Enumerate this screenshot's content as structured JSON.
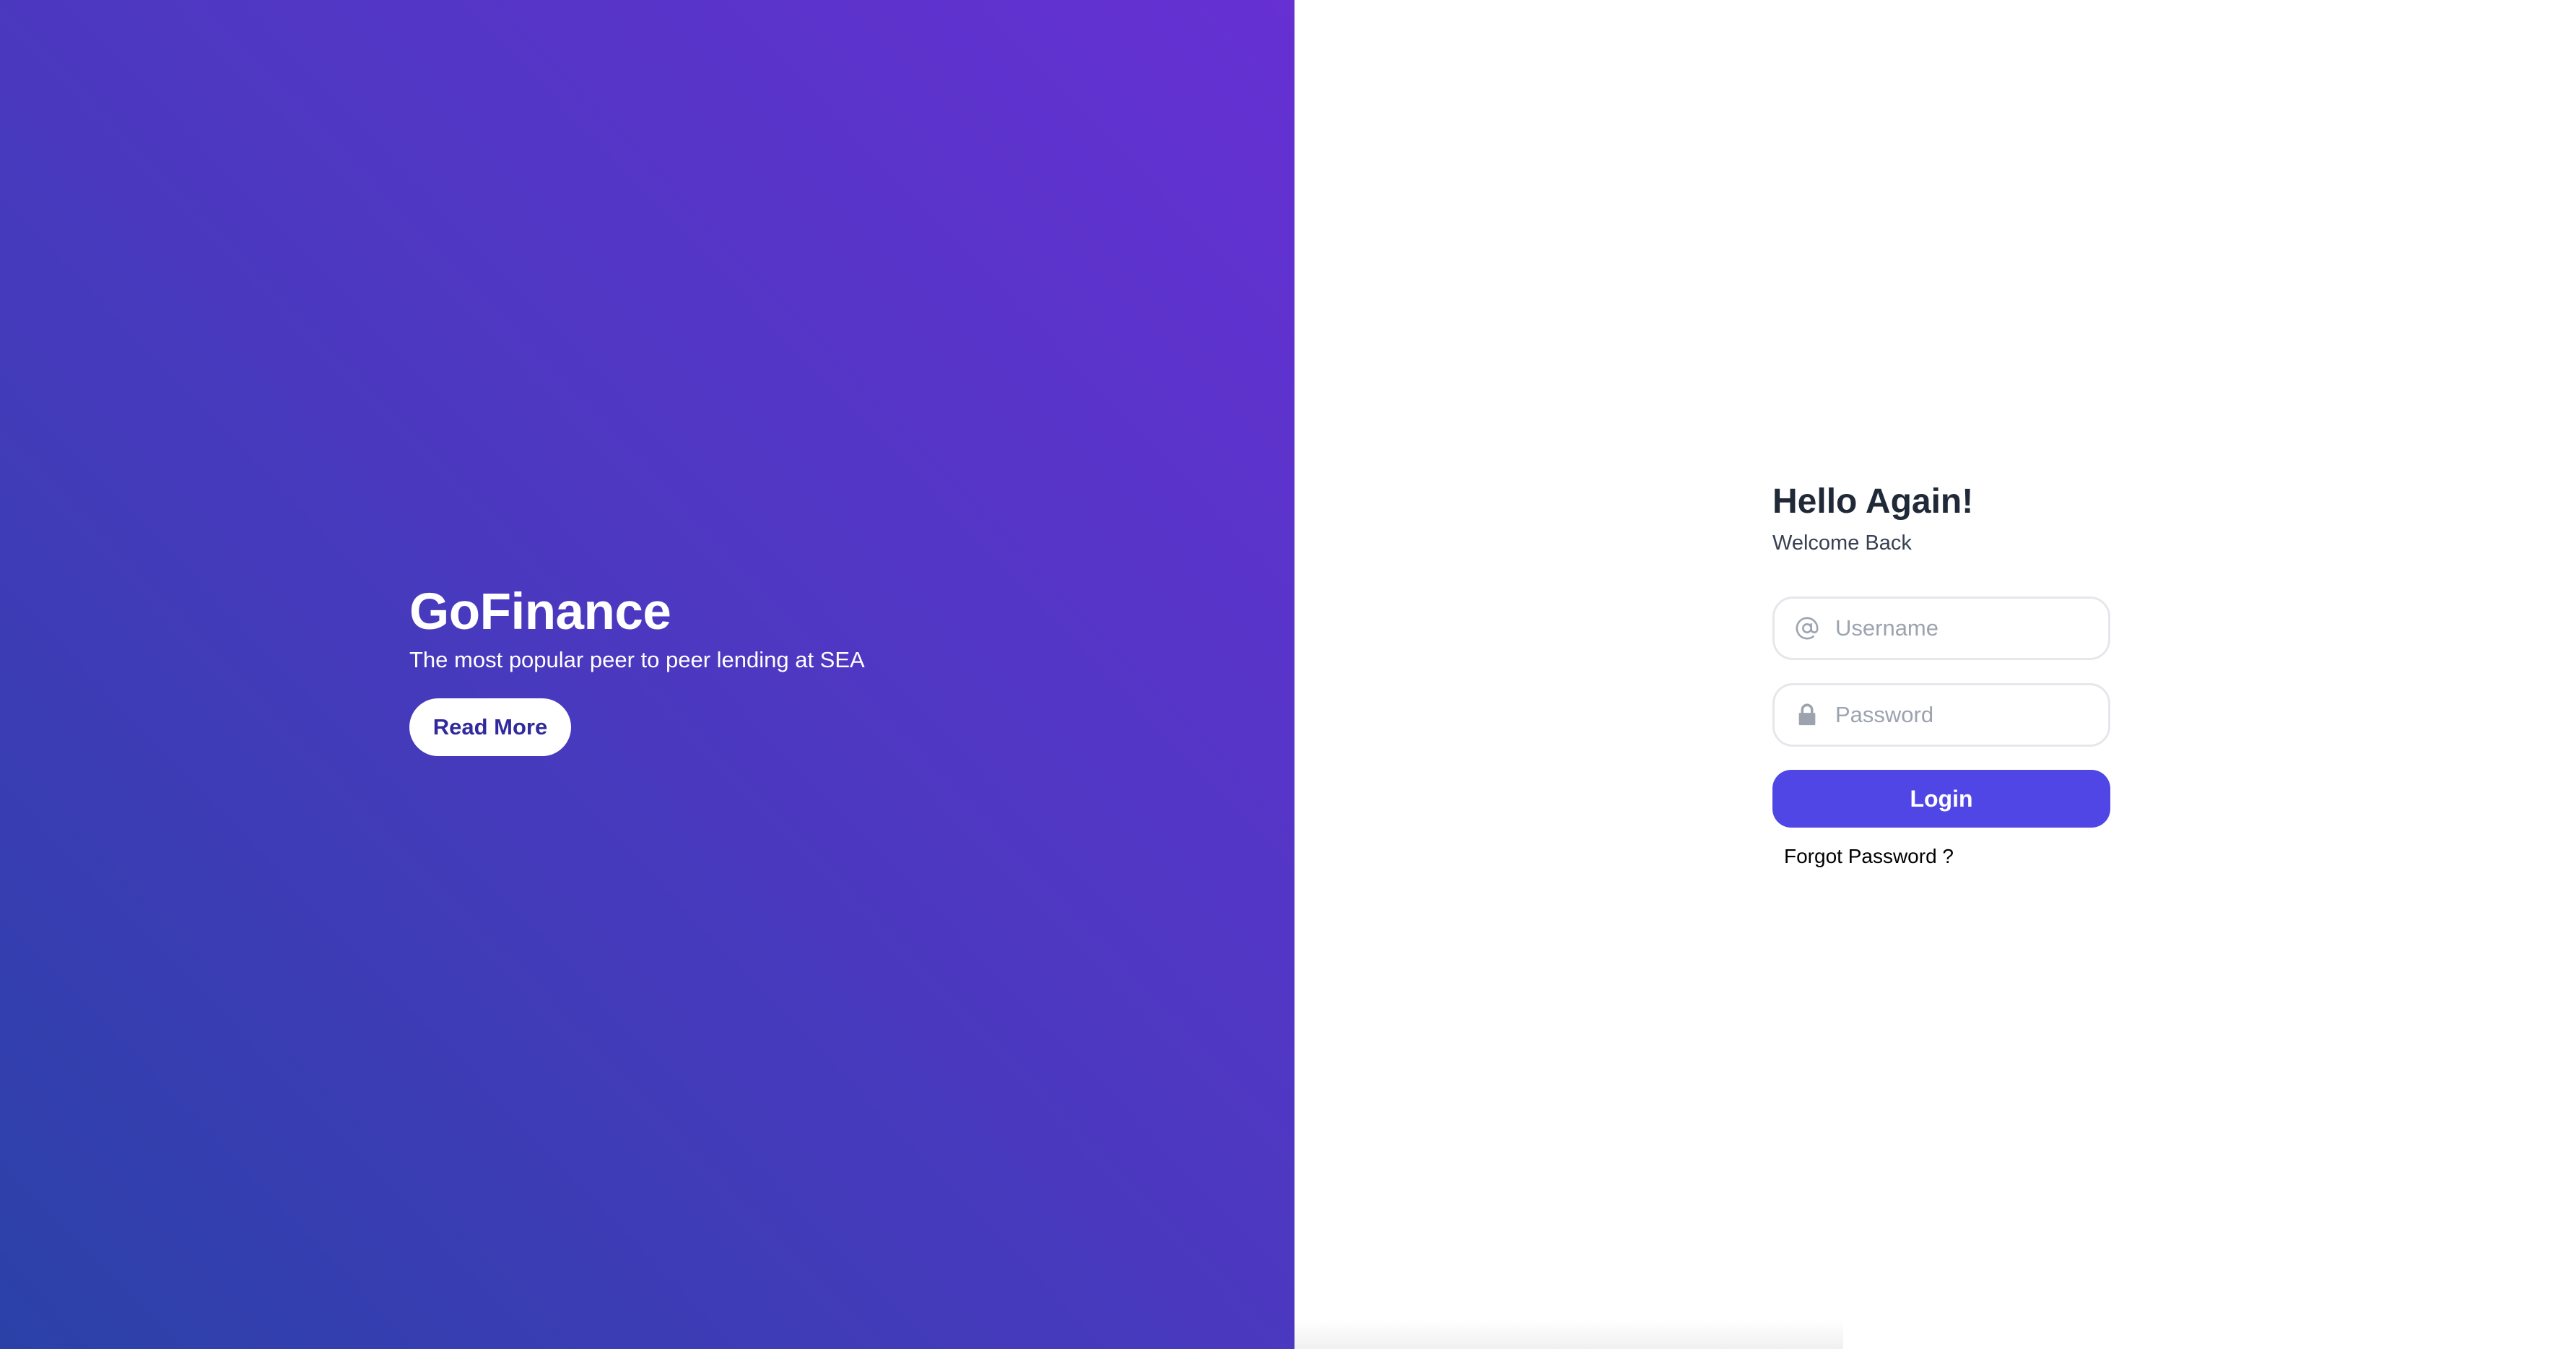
{
  "hero": {
    "title": "GoFinance",
    "tagline": "The most popular peer to peer lending at SEA",
    "read_more_label": "Read More",
    "gradient_colors": [
      "#2b41a8",
      "#4a39bf",
      "#6630d3"
    ]
  },
  "login": {
    "heading": "Hello Again!",
    "subheading": "Welcome Back",
    "username": {
      "placeholder": "Username",
      "value": "",
      "icon": "at-sign-icon"
    },
    "password": {
      "placeholder": "Password",
      "value": "",
      "icon": "lock-icon"
    },
    "submit_label": "Login",
    "forgot_label": "Forgot Password ?",
    "accent_color": "#4f46e5"
  }
}
